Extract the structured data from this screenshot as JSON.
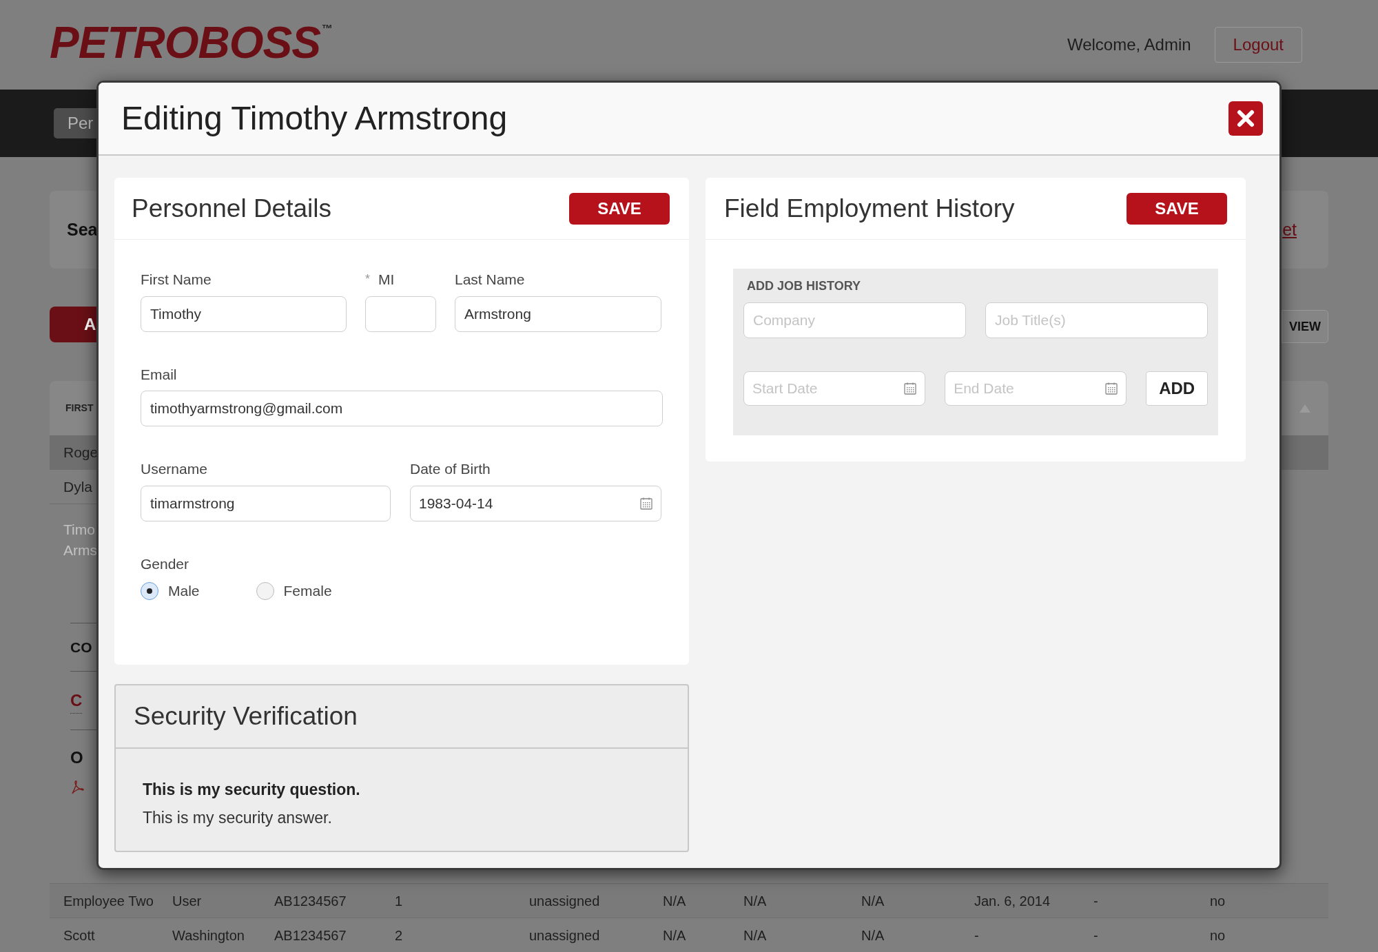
{
  "header": {
    "logo": "PETROBOSS",
    "trademark": "™",
    "welcome": "Welcome, Admin",
    "logout": "Logout"
  },
  "background": {
    "nav_tab": "Per",
    "search_label": "Sea",
    "add_button": "A",
    "table_header": "FIRST",
    "rows": [
      {
        "text": "Roge",
        "selected": true
      },
      {
        "text": "Dyla",
        "selected": false
      }
    ],
    "detail_lines": [
      "Timo",
      "Arms"
    ],
    "section_1": "CO",
    "link_1": "C",
    "section_2": "O",
    "search_link": "et",
    "view_button": "VIEW"
  },
  "table_rows": [
    {
      "cells": [
        "Employee Two",
        "User",
        "AB1234567",
        "1",
        "unassigned",
        "N/A",
        "N/A",
        "N/A",
        "Jan. 6, 2014",
        "-",
        "no"
      ]
    },
    {
      "cells": [
        "Scott",
        "Washington",
        "AB1234567",
        "2",
        "unassigned",
        "N/A",
        "N/A",
        "N/A",
        "-",
        "-",
        "no"
      ]
    }
  ],
  "modal": {
    "title": "Editing Timothy Armstrong",
    "personnel": {
      "title": "Personnel Details",
      "save": "SAVE",
      "first_name": {
        "label": "First Name",
        "value": "Timothy"
      },
      "mi": {
        "label": "MI",
        "required_mark": "*"
      },
      "last_name": {
        "label": "Last Name",
        "value": "Armstrong"
      },
      "email": {
        "label": "Email",
        "value": "timothyarmstrong@gmail.com"
      },
      "username": {
        "label": "Username",
        "value": "timarmstrong"
      },
      "dob": {
        "label": "Date of Birth",
        "value": "1983-04-14"
      },
      "gender": {
        "label": "Gender",
        "options": [
          {
            "label": "Male",
            "selected": true
          },
          {
            "label": "Female",
            "selected": false
          }
        ]
      }
    },
    "security": {
      "title": "Security Verification",
      "question": "This is my security question.",
      "answer": "This is my security answer."
    },
    "employment": {
      "title": "Field Employment History",
      "save": "SAVE",
      "add_title": "ADD JOB HISTORY",
      "company": {
        "placeholder": "Company"
      },
      "job_title": {
        "placeholder": "Job Title(s)"
      },
      "start_date": {
        "placeholder": "Start Date"
      },
      "end_date": {
        "placeholder": "End Date"
      },
      "add": "ADD"
    }
  }
}
